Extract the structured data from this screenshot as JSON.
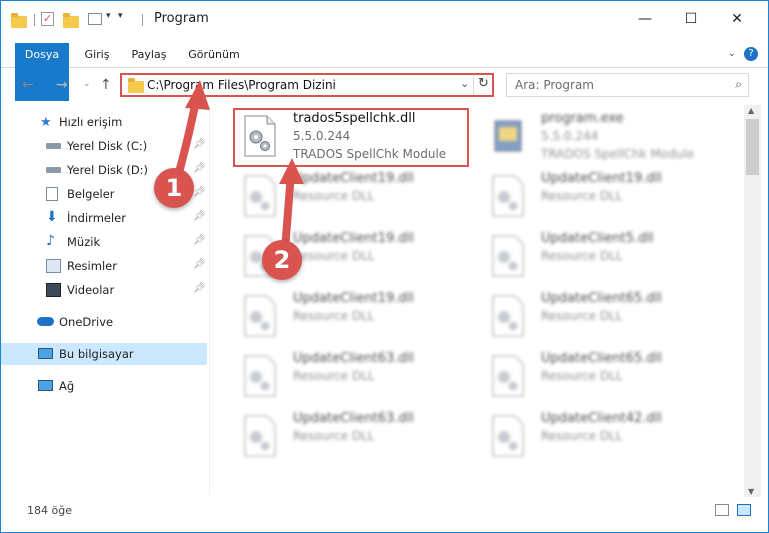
{
  "window": {
    "title": "Program"
  },
  "ribbon": {
    "tabs": [
      "Dosya",
      "Giriş",
      "Paylaş",
      "Görünüm"
    ]
  },
  "address": {
    "path": "C:\\Program Files\\Program Dizini"
  },
  "search": {
    "placeholder": "Ara: Program"
  },
  "sidebar": {
    "items": [
      {
        "label": "Hızlı erişim"
      },
      {
        "label": "Yerel Disk (C:)"
      },
      {
        "label": "Yerel Disk (D:)"
      },
      {
        "label": "Belgeler"
      },
      {
        "label": "İndirmeler"
      },
      {
        "label": "Müzik"
      },
      {
        "label": "Resimler"
      },
      {
        "label": "Videolar"
      },
      {
        "label": "OneDrive"
      },
      {
        "label": "Bu bilgisayar"
      },
      {
        "label": "Ağ"
      }
    ]
  },
  "files": [
    {
      "name": "trados5spellchk.dll",
      "line1": "5.5.0.244",
      "line2": "TRADOS SpellChk Module"
    },
    {
      "name": "program.exe",
      "line1": "5.5.0.244",
      "line2": "TRADOS SpellChk Module"
    },
    {
      "name": "UpdateClient19.dll",
      "line1": "Resource DLL"
    },
    {
      "name": "UpdateClient19.dll",
      "line1": "Resource DLL"
    },
    {
      "name": "UpdateClient19.dll",
      "line1": "Resource DLL"
    },
    {
      "name": "UpdateClient5.dll",
      "line1": "Resource DLL"
    },
    {
      "name": "UpdateClient19.dll",
      "line1": "Resource DLL"
    },
    {
      "name": "UpdateClient65.dll",
      "line1": "Resource DLL"
    },
    {
      "name": "UpdateClient63.dll",
      "line1": "Resource DLL"
    },
    {
      "name": "UpdateClient65.dll",
      "line1": "Resource DLL"
    },
    {
      "name": "UpdateClient63.dll",
      "line1": "Resource DLL"
    },
    {
      "name": "UpdateClient42.dll",
      "line1": "Resource DLL"
    }
  ],
  "status": {
    "count": "184 öğe"
  },
  "callouts": [
    "1",
    "2"
  ],
  "colors": {
    "accent": "#1979ca",
    "highlight": "#d9534f",
    "selected": "#cce8ff"
  }
}
